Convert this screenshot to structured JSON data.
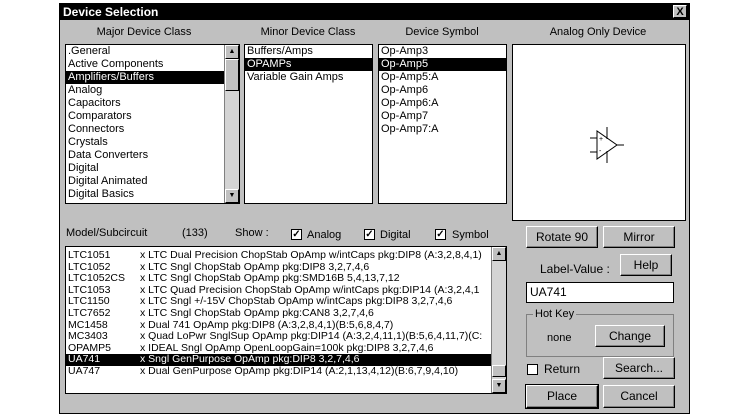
{
  "window": {
    "title": "Device Selection",
    "close_glyph": "X"
  },
  "headers": {
    "major": "Major Device Class",
    "minor": "Minor Device Class",
    "symbol": "Device Symbol",
    "analog": "Analog Only Device"
  },
  "major_classes": [
    ".General",
    "Active Components",
    "Amplifiers/Buffers",
    "Analog",
    "Capacitors",
    "Comparators",
    "Connectors",
    "Crystals",
    "Data Converters",
    "Digital",
    "Digital Animated",
    "Digital Basics"
  ],
  "major_selected": "Amplifiers/Buffers",
  "minor_classes": [
    "Buffers/Amps",
    "OPAMPs",
    "Variable Gain Amps"
  ],
  "minor_selected": "OPAMPs",
  "symbols": [
    "Op-Amp3",
    "Op-Amp5",
    "Op-Amp5:A",
    "Op-Amp6",
    "Op-Amp6:A",
    "Op-Amp7",
    "Op-Amp7:A"
  ],
  "symbol_selected": "Op-Amp5",
  "model": {
    "label": "Model/Subcircuit",
    "count": "(133)",
    "show_label": "Show :",
    "show_analog": "Analog",
    "show_digital": "Digital",
    "show_symbol": "Symbol",
    "check_glyph": "✓"
  },
  "models": [
    {
      "name": "LTC1051",
      "desc": "x LTC Dual Precision ChopStab OpAmp w/intCaps pkg:DIP8 (A:3,2,8,4,1)"
    },
    {
      "name": "LTC1052",
      "desc": "x LTC Sngl ChopStab OpAmp pkg:DIP8 3,2,7,4,6"
    },
    {
      "name": "LTC1052CS",
      "desc": "x LTC Sngl ChopStab OpAmp pkg:SMD16B 5,4,13,7,12"
    },
    {
      "name": "LTC1053",
      "desc": "x LTC Quad Precision ChopStab OpAmp w/intCaps pkg:DIP14 (A:3,2,4,1"
    },
    {
      "name": "LTC1150",
      "desc": "x LTC Sngl +/-15V ChopStab OpAmp w/intCaps pkg:DIP8 3,2,7,4,6"
    },
    {
      "name": "LTC7652",
      "desc": "x LTC Sngl ChopStab OpAmp pkg:CAN8 3,2,7,4,6"
    },
    {
      "name": "MC1458",
      "desc": "x Dual 741 OpAmp pkg:DIP8 (A:3,2,8,4,1)(B:5,6,8,4,7)"
    },
    {
      "name": "MC3403",
      "desc": "x Quad LoPwr SnglSup OpAmp pkg:DIP14 (A:3,2,4,11,1)(B:5,6,4,11,7)(C:"
    },
    {
      "name": "OPAMP5",
      "desc": "x IDEAL Sngl OpAmp OpenLoopGain=100k pkg:DIP8 3,2,7,4,6"
    },
    {
      "name": "UA741",
      "desc": "x Sngl GenPurpose OpAmp pkg:DIP8 3,2,7,4,6"
    },
    {
      "name": "UA747",
      "desc": "x Dual GenPurpose OpAmp pkg:DIP14 (A:2,1,13,4,12)(B:6,7,9,4,10)"
    }
  ],
  "model_selected": "UA741",
  "buttons": {
    "rotate": "Rotate 90",
    "mirror": "Mirror",
    "help": "Help",
    "change": "Change",
    "search": "Search...",
    "place": "Place",
    "cancel": "Cancel"
  },
  "label_value": {
    "label": "Label-Value :",
    "value": "UA741"
  },
  "hot_key": {
    "title": "Hot Key",
    "value": "none"
  },
  "return_label": "Return"
}
